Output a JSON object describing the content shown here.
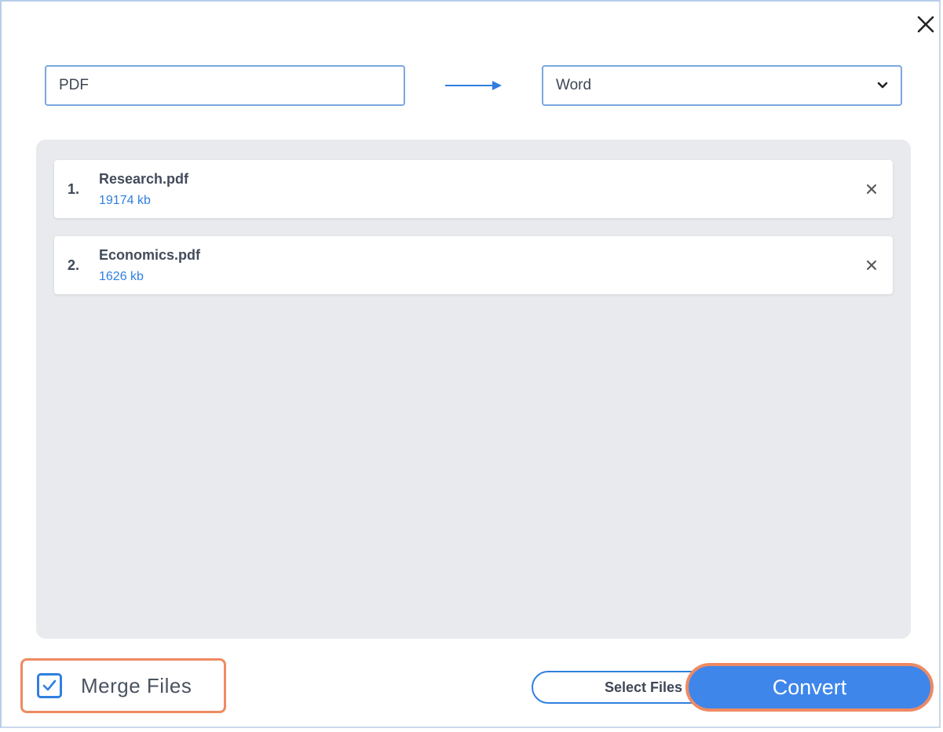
{
  "colors": {
    "accent": "#2f7fe0",
    "convert_fill": "#3e86ea",
    "highlight": "#ee8a63",
    "file_area": "#e8eaee"
  },
  "icons": {
    "close": "close-icon",
    "arrow": "arrow-right-icon",
    "dropdown": "chevron-down-icon",
    "remove": "remove-file-icon",
    "check": "checkmark-icon"
  },
  "conversion": {
    "source_format": "PDF",
    "target_format": "Word"
  },
  "files": [
    {
      "index": "1.",
      "name": "Research.pdf",
      "size": "19174 kb"
    },
    {
      "index": "2.",
      "name": "Economics.pdf",
      "size": "1626 kb"
    }
  ],
  "footer": {
    "merge_label": "Merge Files",
    "merge_checked": true,
    "select_files_label": "Select Files",
    "convert_label": "Convert"
  }
}
